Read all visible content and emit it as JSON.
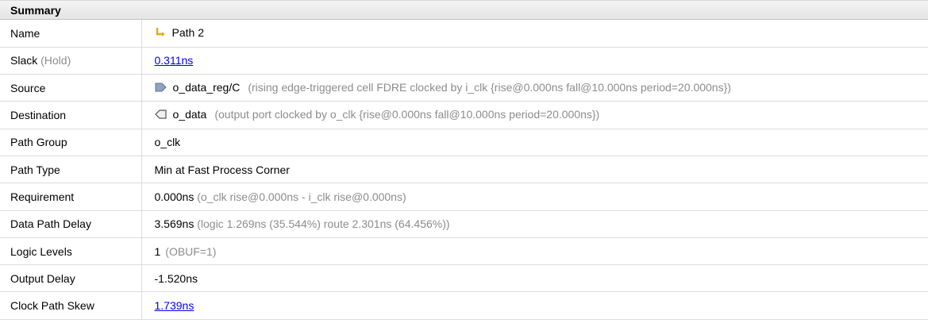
{
  "panel": {
    "title": "Summary"
  },
  "rows": {
    "name": {
      "key": "Name",
      "value": "Path 2",
      "icon": "path-arrow-icon"
    },
    "slack": {
      "key": "Slack",
      "key_suffix": "(Hold)",
      "value": "0.311ns"
    },
    "source": {
      "key": "Source",
      "value": "o_data_reg/C",
      "detail": "(rising edge-triggered cell FDRE clocked by i_clk  {rise@0.000ns fall@10.000ns period=20.000ns})",
      "icon": "cell-pin-icon"
    },
    "destination": {
      "key": "Destination",
      "value": "o_data",
      "detail": "(output port clocked by o_clk  {rise@0.000ns fall@10.000ns period=20.000ns})",
      "icon": "output-port-icon"
    },
    "path_group": {
      "key": "Path Group",
      "value": "o_clk"
    },
    "path_type": {
      "key": "Path Type",
      "value": "Min at Fast Process Corner"
    },
    "requirement": {
      "key": "Requirement",
      "value": "0.000ns",
      "detail": "(o_clk rise@0.000ns - i_clk rise@0.000ns)"
    },
    "data_path_delay": {
      "key": "Data Path Delay",
      "value": "3.569ns",
      "detail": "(logic 1.269ns (35.544%)  route 2.301ns (64.456%))"
    },
    "logic_levels": {
      "key": "Logic Levels",
      "value": "1",
      "detail": "(OBUF=1)"
    },
    "output_delay": {
      "key": "Output Delay",
      "value": "-1.520ns"
    },
    "clock_path_skew": {
      "key": "Clock Path Skew",
      "value": "1.739ns"
    }
  },
  "colors": {
    "link": "#0000ee",
    "muted": "#8c8c8c",
    "icon_accent": "#e6a817"
  }
}
